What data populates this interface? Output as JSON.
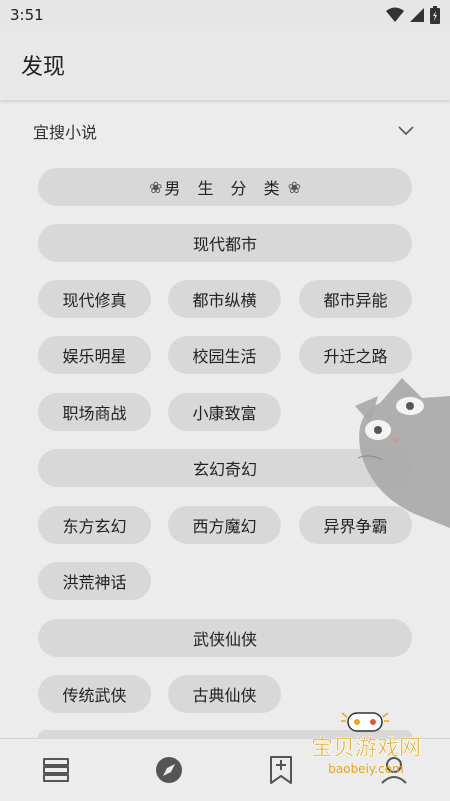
{
  "status_bar": {
    "time": "3:51"
  },
  "app_bar": {
    "title": "发现"
  },
  "source": {
    "name": "宜搜小说"
  },
  "sections": [
    {
      "header": "男 生 分 类",
      "groups": [
        {
          "title": "现代都市",
          "items": [
            "现代修真",
            "都市纵横",
            "都市异能",
            "娱乐明星",
            "校园生活",
            "升迁之路",
            "职场商战",
            "小康致富"
          ]
        },
        {
          "title": "玄幻奇幻",
          "items": [
            "东方玄幻",
            "西方魔幻",
            "异界争霸",
            "洪荒神话"
          ]
        },
        {
          "title": "武侠仙侠",
          "items": [
            "传统武侠",
            "古典仙侠"
          ]
        }
      ]
    }
  ],
  "bottom_nav": {
    "items": [
      {
        "icon": "bookshelf-icon"
      },
      {
        "icon": "compass-icon"
      },
      {
        "icon": "bookmark-icon"
      },
      {
        "icon": "person-icon"
      }
    ]
  },
  "watermark": {
    "title": "宝贝游戏网",
    "url": "baobeiy.com",
    "color": "#e6a817"
  }
}
